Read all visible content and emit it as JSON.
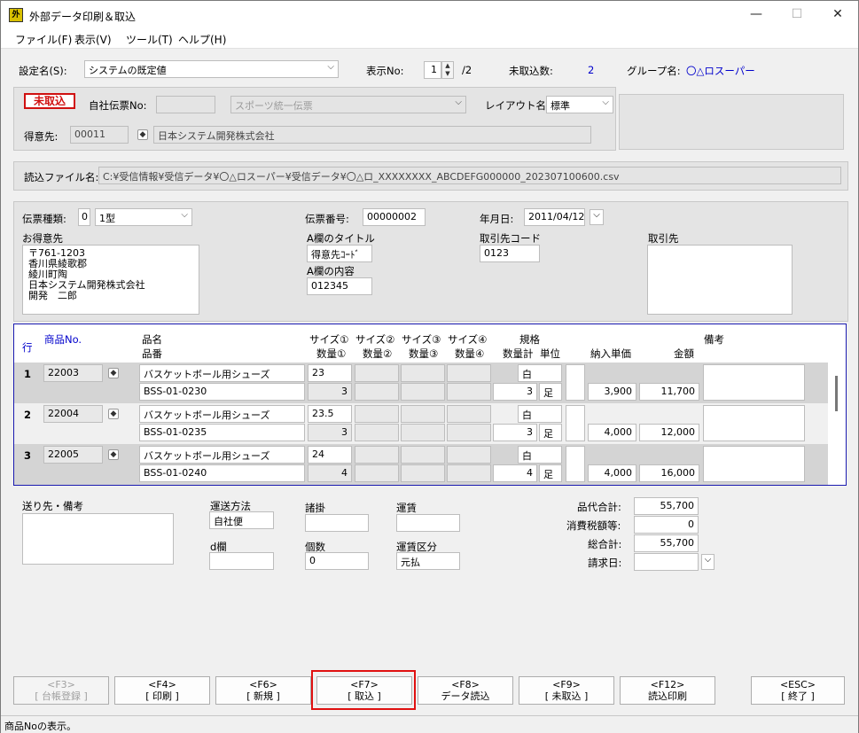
{
  "window": {
    "title": "外部データ印刷＆取込",
    "app_icon": "外",
    "minimize": "—",
    "maximize": "☐",
    "close": "✕"
  },
  "menu": [
    "ファイル(F)",
    "表示(V)",
    "ツール(T)",
    "ヘルプ(H)"
  ],
  "top": {
    "settings_label": "設定名(S):",
    "settings_value": "システムの既定値",
    "display_no_label": "表示No:",
    "display_no_value": "1",
    "display_no_total": "/2",
    "unimported_label": "未取込数:",
    "unimported_value": "2",
    "group_label": "グループ名:",
    "group_value": "〇△ロスーパー"
  },
  "slip": {
    "stamp": "未取込",
    "own_slip_label": "自社伝票No:",
    "own_slip_value": "",
    "slip_type_value": "スポーツ統一伝票",
    "layout_label": "レイアウト名:",
    "layout_value": "標準",
    "customer_label": "得意先:",
    "customer_code": "00011",
    "customer_name": "日本システム開発株式会社"
  },
  "file": {
    "label": "読込ファイル名:",
    "path": "C:¥受信情報¥受信データ¥〇△ロスーパー¥受信データ¥〇△ロ_XXXXXXXX_ABCDEFG000000_202307100600.csv"
  },
  "header": {
    "slip_kind_label": "伝票種類:",
    "slip_kind_code": "0",
    "slip_kind_value": "1型",
    "slip_no_label": "伝票番号:",
    "slip_no_value": "00000002",
    "date_label": "年月日:",
    "date_value": "2011/04/12",
    "customer_label": "お得意先",
    "customer_address": "〒761-1203\n香川県綾歌郡\n綾川町陶\n日本システム開発株式会社\n開発　二郎",
    "a_title_label": "A欄のタイトル",
    "a_title_value": "得意先ｺｰﾄﾞ",
    "a_content_label": "A欄の内容",
    "a_content_value": "012345",
    "partner_code_label": "取引先コード",
    "partner_code_value": "0123",
    "partner_label": "取引先"
  },
  "grid": {
    "headers": {
      "row": "行",
      "product_no": "商品No.",
      "name": "品名",
      "code": "品番",
      "size1": "サイズ①",
      "size2": "サイズ②",
      "size3": "サイズ③",
      "size4": "サイズ④",
      "qty1": "数量①",
      "qty2": "数量②",
      "qty3": "数量③",
      "qty4": "数量④",
      "spec": "規格",
      "qty_total": "数量計",
      "unit": "単位",
      "unit_price": "納入単価",
      "amount": "金額",
      "note": "備考"
    },
    "rows": [
      {
        "no": "1",
        "product_no": "22003",
        "name": "バスケットボール用シューズ",
        "code": "BSS-01-0230",
        "size1": "23",
        "qty1": "3",
        "spec": "白",
        "qty_total": "3",
        "unit": "足",
        "unit_price": "3,900",
        "amount": "11,700"
      },
      {
        "no": "2",
        "product_no": "22004",
        "name": "バスケットボール用シューズ",
        "code": "BSS-01-0235",
        "size1": "23.5",
        "qty1": "3",
        "spec": "白",
        "qty_total": "3",
        "unit": "足",
        "unit_price": "4,000",
        "amount": "12,000"
      },
      {
        "no": "3",
        "product_no": "22005",
        "name": "バスケットボール用シューズ",
        "code": "BSS-01-0240",
        "size1": "24",
        "qty1": "4",
        "spec": "白",
        "qty_total": "4",
        "unit": "足",
        "unit_price": "4,000",
        "amount": "16,000"
      }
    ]
  },
  "footer": {
    "note_label": "送り先・備考",
    "transport_label": "運送方法",
    "transport_value": "自社便",
    "d_label": "d欄",
    "d_value": "",
    "misc_label": "諸掛",
    "misc_value": "",
    "count_label": "個数",
    "count_value": "0",
    "freight_label": "運賃",
    "freight_value": "",
    "freight_type_label": "運賃区分",
    "freight_type_value": "元払",
    "subtotal_label": "品代合計:",
    "subtotal_value": "55,700",
    "tax_label": "消費税額等:",
    "tax_value": "0",
    "total_label": "総合計:",
    "total_value": "55,700",
    "billing_label": "請求日:",
    "billing_value": ""
  },
  "buttons": [
    {
      "key": "<F3>",
      "label": "[ 台帳登録 ]"
    },
    {
      "key": "<F4>",
      "label": "[ 印刷 ]"
    },
    {
      "key": "<F6>",
      "label": "[ 新規 ]"
    },
    {
      "key": "<F7>",
      "label": "[ 取込 ]"
    },
    {
      "key": "<F8>",
      "label": "データ読込"
    },
    {
      "key": "<F9>",
      "label": "[ 未取込 ]"
    },
    {
      "key": "<F12>",
      "label": "読込印刷"
    },
    {
      "key": "<ESC>",
      "label": "[ 終了 ]"
    }
  ],
  "status": "商品Noの表示。"
}
